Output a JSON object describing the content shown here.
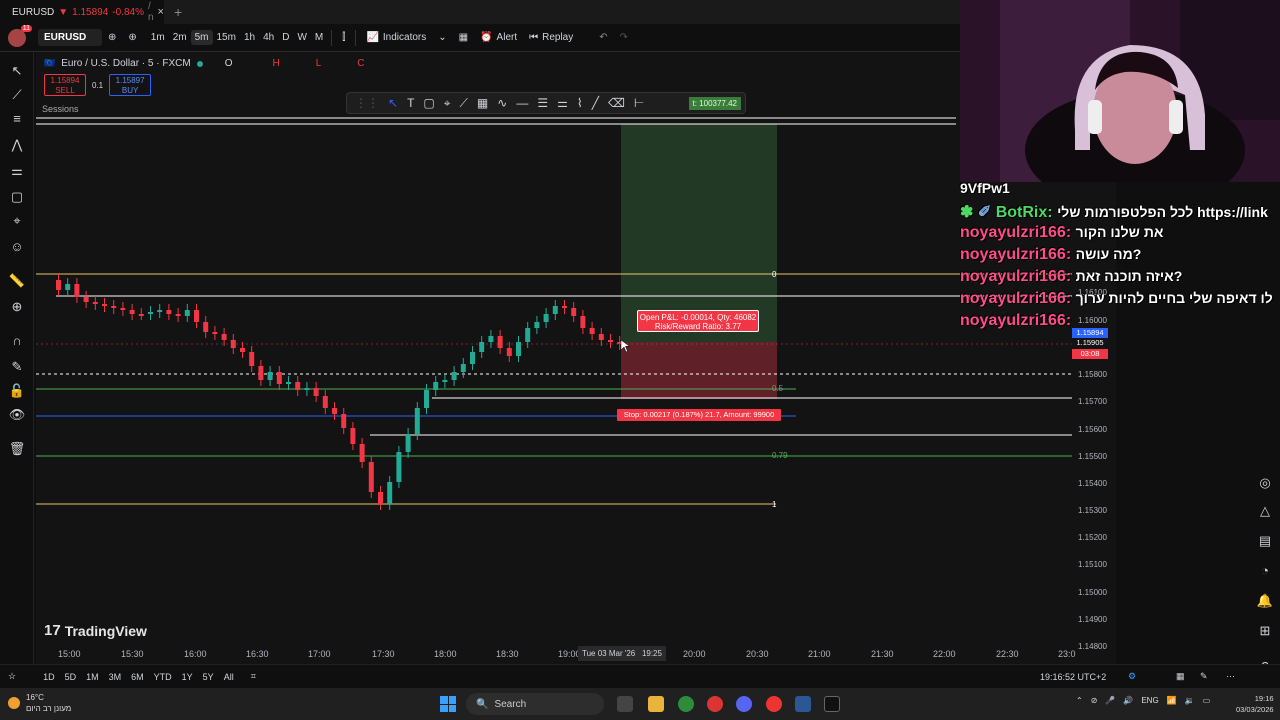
{
  "browser_tab": {
    "symbol": "EURUSD",
    "arrow": "▼",
    "price": "1.15894",
    "change": "-0.84%",
    "rest": "/ n",
    "close": "×",
    "newtab": "+"
  },
  "toolbar": {
    "avatar_badge": "11",
    "symbol": "EURUSD",
    "intervals": [
      "1m",
      "2m",
      "5m",
      "15m",
      "1h",
      "4h",
      "D",
      "W",
      "M"
    ],
    "active_interval": "5m",
    "indicators": "Indicators",
    "alert": "Alert",
    "replay": "Replay"
  },
  "chart": {
    "title": "Euro / U.S. Dollar · 5 · FXCM",
    "ohlc": {
      "o": "O",
      "h": "H",
      "l": "L",
      "c": "C"
    },
    "sell": {
      "price": "1.15894",
      "label": "SELL"
    },
    "spread": "0.1",
    "buy": {
      "price": "1.15897",
      "label": "BUY"
    },
    "sessions": "Sessions",
    "watermark": "TradingView",
    "position": {
      "pnl_line1": "Open P&L: -0.00014, Qty: 46082",
      "pnl_line2": "Risk/Reward Ratio: 3.77",
      "stop": "Stop: 0.00217 (0.187%) 21.7, Amount: 99900",
      "balance": "t: 100377.42"
    },
    "fib_labels": [
      "0",
      "0.5",
      "0.79",
      "1"
    ],
    "price_axis": [
      "1.16100",
      "1.16000",
      "1.15800",
      "1.15700",
      "1.15600",
      "1.15500",
      "1.15400",
      "1.15300",
      "1.15200",
      "1.15100",
      "1.15000",
      "1.14900",
      "1.14800"
    ],
    "price_tags": {
      "current": "1.15905",
      "countdown": "03:08",
      "top": "1.15894"
    },
    "time_axis": [
      "15:00",
      "15:30",
      "16:00",
      "16:30",
      "17:00",
      "17:30",
      "18:00",
      "18:30",
      "19:00",
      "20:00",
      "20:30",
      "21:00",
      "21:30",
      "22:00",
      "22:30",
      "23:0"
    ],
    "crosshair_time": "Tue 03 Mar '26",
    "crosshair_time2": "19:25",
    "colors": {
      "up": "#22ab94",
      "down": "#f23645",
      "profit_zone": "#2e5a34",
      "loss_zone": "#7a2630"
    }
  },
  "bottom": {
    "ranges": [
      "1D",
      "5D",
      "1M",
      "3M",
      "6M",
      "YTD",
      "1Y",
      "5Y",
      "All"
    ],
    "clock": "19:16:52 UTC+2"
  },
  "taskbar": {
    "temp": "16°C",
    "weather_desc": "מעונן רב היום",
    "search": "Search",
    "lang": "ENG",
    "time": "19:16",
    "date": "03/03/2026"
  },
  "stream": {
    "chat": [
      {
        "name": "9VfPw1",
        "msg": ""
      },
      {
        "name": "BotRix:",
        "msg": "לכל הפלטפורמות שלי https://link",
        "bot": true
      },
      {
        "name": "noyayulzri166:",
        "msg": "את שלנו הקור"
      },
      {
        "name": "noyayulzri166:",
        "msg": "מה עושה?"
      },
      {
        "name": "noyayulzri166:",
        "msg": "איזה תוכנה זאת?"
      },
      {
        "name": "noyayulzri166:",
        "msg": "לו דאיפה שלי בחיים להיות ערוך"
      },
      {
        "name": "noyayulzri166:",
        "msg": ""
      }
    ]
  }
}
